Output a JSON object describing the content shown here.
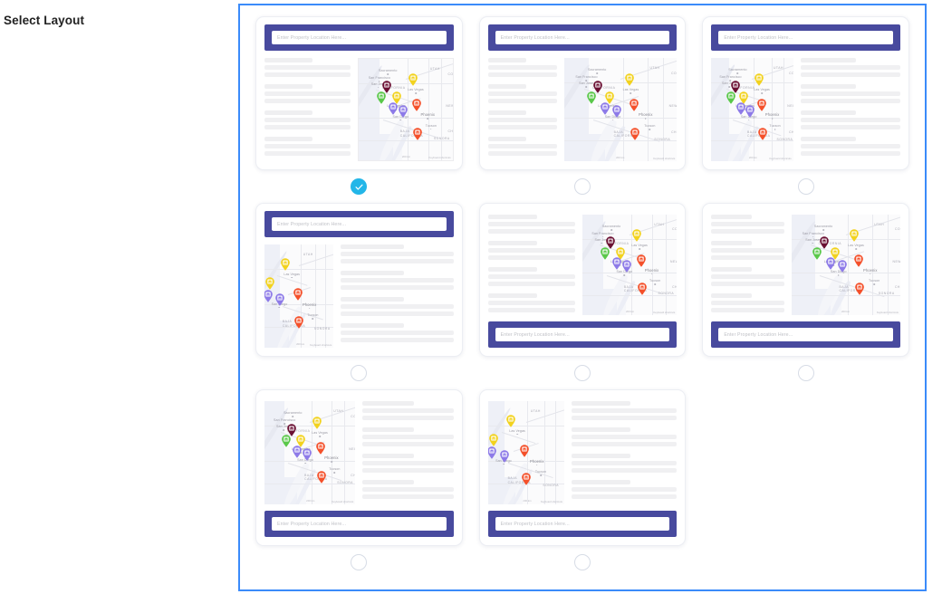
{
  "page": {
    "title": "Select Layout",
    "accent_border_color": "#3b8bfa",
    "searchbar_color": "#484a9e",
    "selected_radio_color": "#23b6e8"
  },
  "search": {
    "placeholder": "Enter Property Location Here..."
  },
  "map": {
    "labels": [
      {
        "text": "Sacramento",
        "kind": "dot"
      },
      {
        "text": "San Francisco",
        "kind": "dot"
      },
      {
        "text": "San Jose",
        "kind": "dot"
      },
      {
        "text": "CALIFORNIA",
        "kind": "state"
      },
      {
        "text": "Las Vegas",
        "kind": "dot"
      },
      {
        "text": "Los Angeles",
        "kind": "dot"
      },
      {
        "text": "San Diego",
        "kind": "dot"
      },
      {
        "text": "Phoenix",
        "kind": "big"
      },
      {
        "text": "Tucson",
        "kind": "dot"
      },
      {
        "text": "BAJA CALIFORNIA",
        "kind": "state"
      },
      {
        "text": "SONORA",
        "kind": "state"
      },
      {
        "text": "UTAH",
        "kind": "state"
      },
      {
        "text": "COLO.",
        "kind": "state"
      },
      {
        "text": "NEW MEXICO",
        "kind": "state"
      },
      {
        "text": "CHIHUAHUA",
        "kind": "state"
      },
      {
        "text": "BAJA CALIFORNIA SUR",
        "kind": "state"
      }
    ],
    "attribution": "Keyboard shortcuts",
    "scale": "200 km",
    "pins": [
      {
        "label": "San Jose property",
        "color": "#6b1033",
        "icon": "home-pin-icon"
      },
      {
        "label": "Los Angeles property",
        "color": "#5ac84a",
        "icon": "home-pin-icon"
      },
      {
        "label": "Las Vegas property",
        "color": "#f2d21e",
        "icon": "home-pin-icon"
      },
      {
        "label": "Inland Empire property",
        "color": "#f2d21e",
        "icon": "home-pin-icon"
      },
      {
        "label": "San Diego property",
        "color": "#8d7ae8",
        "icon": "home-pin-icon"
      },
      {
        "label": "Imperial Valley property",
        "color": "#8d7ae8",
        "icon": "home-pin-icon"
      },
      {
        "label": "Phoenix property",
        "color": "#f4502a",
        "icon": "home-pin-icon"
      },
      {
        "label": "Sonora property",
        "color": "#f4502a",
        "icon": "home-pin-icon"
      }
    ]
  },
  "layouts": [
    {
      "id": "layout-1",
      "name": "Search top, content left, map right",
      "selected": true,
      "search_position": "top",
      "order": "text-first",
      "text_flex": 48,
      "map_flex": 52,
      "map_bordered": true,
      "map_zoom": "wide",
      "text_groups": 4
    },
    {
      "id": "layout-2",
      "name": "Search top, narrow content left, wide map right",
      "selected": false,
      "search_position": "top",
      "order": "text-first",
      "text_flex": 38,
      "map_flex": 62,
      "map_bordered": false,
      "map_zoom": "wide",
      "text_groups": 4
    },
    {
      "id": "layout-3",
      "name": "Search top, map left, content right",
      "selected": false,
      "search_position": "top",
      "order": "map-first",
      "text_flex": 55,
      "map_flex": 45,
      "map_bordered": false,
      "map_zoom": "wide",
      "text_groups": 4
    },
    {
      "id": "layout-4",
      "name": "Search top, small map left, content right",
      "selected": false,
      "search_position": "top",
      "order": "map-first",
      "text_flex": 62,
      "map_flex": 38,
      "map_bordered": false,
      "map_zoom": "close",
      "text_groups": 4
    },
    {
      "id": "layout-5",
      "name": "Content left, map right, search bottom",
      "selected": false,
      "search_position": "bottom",
      "order": "text-first",
      "text_flex": 48,
      "map_flex": 52,
      "map_bordered": false,
      "map_zoom": "wide",
      "text_groups": 4
    },
    {
      "id": "layout-6",
      "name": "Narrow content left, wide map right, search bottom",
      "selected": false,
      "search_position": "bottom",
      "order": "text-first",
      "text_flex": 40,
      "map_flex": 60,
      "map_bordered": false,
      "map_zoom": "wide",
      "text_groups": 4
    },
    {
      "id": "layout-7",
      "name": "Map left, content right, search bottom",
      "selected": false,
      "search_position": "bottom",
      "order": "map-first",
      "text_flex": 50,
      "map_flex": 50,
      "map_bordered": false,
      "map_zoom": "wide",
      "text_groups": 4
    },
    {
      "id": "layout-8",
      "name": "Small map left, content right, search bottom",
      "selected": false,
      "search_position": "bottom",
      "order": "map-first",
      "text_flex": 58,
      "map_flex": 42,
      "map_bordered": false,
      "map_zoom": "close",
      "text_groups": 4
    }
  ]
}
